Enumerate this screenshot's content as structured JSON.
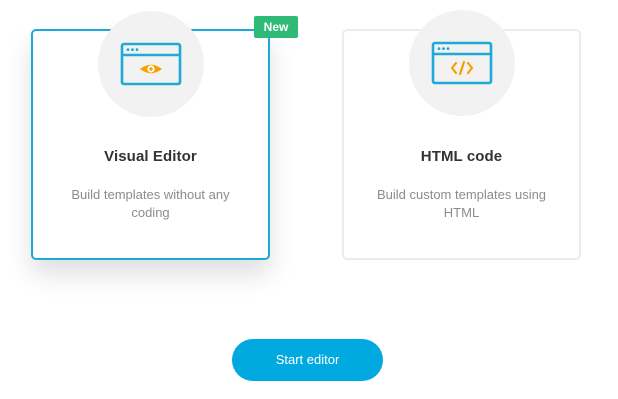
{
  "cards": [
    {
      "title": "Visual Editor",
      "description": "Build templates without any coding",
      "icon": "browser-eye-icon",
      "badge": "New",
      "selected": true
    },
    {
      "title": "HTML code",
      "description": "Build custom templates using HTML",
      "icon": "browser-code-icon",
      "selected": false
    }
  ],
  "start_button_label": "Start editor",
  "colors": {
    "accent": "#1fa9d6",
    "button": "#00a9e0",
    "badge": "#2fba77",
    "icon_orange": "#f5a100",
    "icon_blue": "#1fa9d6"
  }
}
